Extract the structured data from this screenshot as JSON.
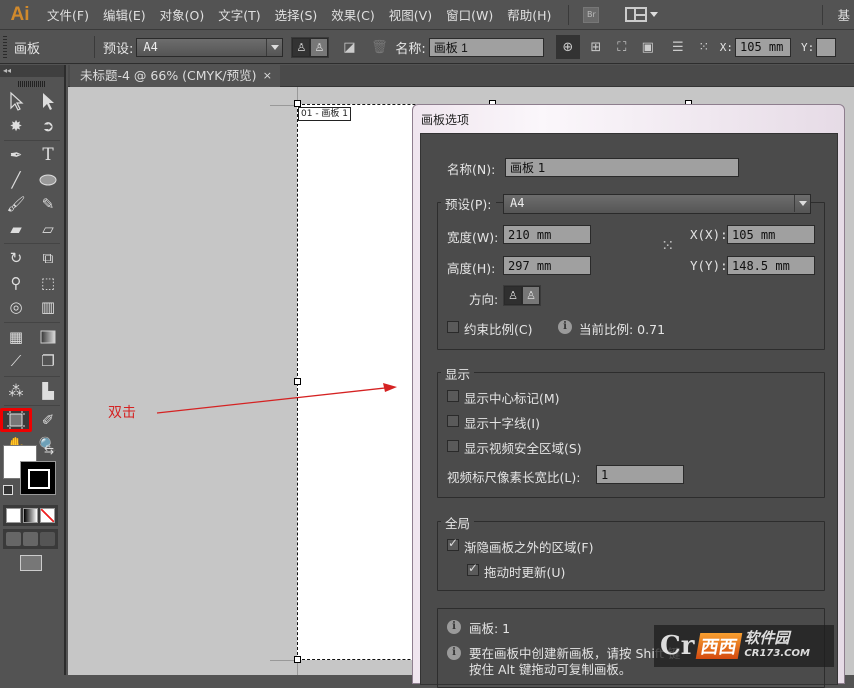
{
  "app": {
    "logo": "Ai"
  },
  "menubar": {
    "items": [
      "文件(F)",
      "编辑(E)",
      "对象(O)",
      "文字(T)",
      "选择(S)",
      "效果(C)",
      "视图(V)",
      "窗口(W)",
      "帮助(H)"
    ],
    "bridge_label": "Br",
    "workspace_partial": "基"
  },
  "controlbar": {
    "tool_name": "画板",
    "preset_label": "预设:",
    "preset_value": "A4",
    "name_label": "名称:",
    "name_value": "画板 1",
    "x_label": "X:",
    "x_value": "105 mm",
    "y_label": "Y:"
  },
  "document": {
    "tab_title": "未标题-4 @ 66% (CMYK/预览)",
    "close_glyph": "×",
    "artboard_label": "01 - 画板 1"
  },
  "annotation": {
    "text": "双击",
    "color": "#d52222"
  },
  "dialog": {
    "title": "画板选项",
    "name_label": "名称(N):",
    "name_value": "画板 1",
    "preset_label": "预设(P):",
    "preset_value": "A4",
    "width_label": "宽度(W):",
    "width_value": "210 mm",
    "height_label": "高度(H):",
    "height_value": "297 mm",
    "x_label": "X(X):",
    "x_value": "105 mm",
    "y_label": "Y(Y):",
    "y_value": "148.5 mm",
    "orientation_label": "方向:",
    "constrain_label": "约束比例(C)",
    "constrain_checked": false,
    "ratio_label": "当前比例: 0.71",
    "display_group": "显示",
    "show_center_label": "显示中心标记(M)",
    "show_center_checked": false,
    "show_cross_label": "显示十字线(I)",
    "show_cross_checked": false,
    "show_safe_label": "显示视频安全区域(S)",
    "show_safe_checked": false,
    "pixel_ratio_label": "视频标尺像素长宽比(L):",
    "pixel_ratio_value": "1",
    "global_group": "全局",
    "fade_label": "渐隐画板之外的区域(F)",
    "fade_checked": true,
    "update_label": "拖动时更新(U)",
    "update_checked": true,
    "info_artboards": "画板: 1",
    "info_tip_line1": "要在画板中创建新画板，请按 Shift 键",
    "info_tip_line2": "按住 Alt 键拖动可复制画板。"
  },
  "watermark": {
    "c": "Cr",
    "xx": "西西",
    "cn": "软件园",
    "url": "CR173.COM"
  }
}
